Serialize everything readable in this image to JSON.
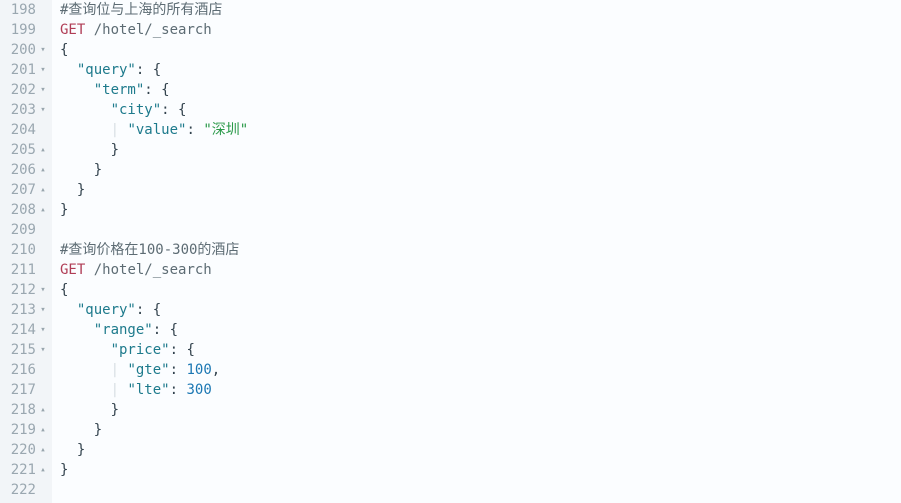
{
  "startLine": 198,
  "lines": [
    {
      "n": 198,
      "fold": "",
      "segs": [
        {
          "c": "tok-cm",
          "t": "#查询位与上海的所有酒店"
        }
      ]
    },
    {
      "n": 199,
      "fold": "",
      "segs": [
        {
          "c": "tok-mt",
          "t": "GET"
        },
        {
          "c": "",
          "t": " "
        },
        {
          "c": "tok-pt",
          "t": "/hotel/_search"
        }
      ]
    },
    {
      "n": 200,
      "fold": "dn",
      "segs": [
        {
          "c": "tok-pu",
          "t": "{"
        }
      ]
    },
    {
      "n": 201,
      "fold": "dn",
      "segs": [
        {
          "c": "",
          "t": "  "
        },
        {
          "c": "tok-ky",
          "t": "\"query\""
        },
        {
          "c": "tok-pu",
          "t": ": {"
        }
      ]
    },
    {
      "n": 202,
      "fold": "dn",
      "segs": [
        {
          "c": "",
          "t": "    "
        },
        {
          "c": "tok-ky",
          "t": "\"term\""
        },
        {
          "c": "tok-pu",
          "t": ": {"
        }
      ]
    },
    {
      "n": 203,
      "fold": "dn",
      "segs": [
        {
          "c": "",
          "t": "      "
        },
        {
          "c": "tok-ky",
          "t": "\"city\""
        },
        {
          "c": "tok-pu",
          "t": ": {"
        }
      ]
    },
    {
      "n": 204,
      "fold": "",
      "segs": [
        {
          "c": "",
          "t": "      "
        },
        {
          "c": "indent-guide",
          "t": "|"
        },
        {
          "c": "",
          "t": " "
        },
        {
          "c": "tok-ky",
          "t": "\"value\""
        },
        {
          "c": "tok-pu",
          "t": ": "
        },
        {
          "c": "tok-st",
          "t": "\"深圳\""
        }
      ]
    },
    {
      "n": 205,
      "fold": "up",
      "segs": [
        {
          "c": "",
          "t": "      "
        },
        {
          "c": "tok-pu",
          "t": "}"
        }
      ]
    },
    {
      "n": 206,
      "fold": "up",
      "segs": [
        {
          "c": "",
          "t": "    "
        },
        {
          "c": "tok-pu",
          "t": "}"
        }
      ]
    },
    {
      "n": 207,
      "fold": "up",
      "segs": [
        {
          "c": "",
          "t": "  "
        },
        {
          "c": "tok-pu",
          "t": "}"
        }
      ]
    },
    {
      "n": 208,
      "fold": "up",
      "segs": [
        {
          "c": "tok-pu",
          "t": "}"
        }
      ]
    },
    {
      "n": 209,
      "fold": "",
      "segs": []
    },
    {
      "n": 210,
      "fold": "",
      "segs": [
        {
          "c": "tok-cm",
          "t": "#查询价格在100-300的酒店"
        }
      ]
    },
    {
      "n": 211,
      "fold": "",
      "segs": [
        {
          "c": "tok-mt",
          "t": "GET"
        },
        {
          "c": "",
          "t": " "
        },
        {
          "c": "tok-pt",
          "t": "/hotel/_search"
        }
      ]
    },
    {
      "n": 212,
      "fold": "dn",
      "segs": [
        {
          "c": "tok-pu",
          "t": "{"
        }
      ]
    },
    {
      "n": 213,
      "fold": "dn",
      "segs": [
        {
          "c": "",
          "t": "  "
        },
        {
          "c": "tok-ky",
          "t": "\"query\""
        },
        {
          "c": "tok-pu",
          "t": ": {"
        }
      ]
    },
    {
      "n": 214,
      "fold": "dn",
      "segs": [
        {
          "c": "",
          "t": "    "
        },
        {
          "c": "tok-ky",
          "t": "\"range\""
        },
        {
          "c": "tok-pu",
          "t": ": {"
        }
      ]
    },
    {
      "n": 215,
      "fold": "dn",
      "segs": [
        {
          "c": "",
          "t": "      "
        },
        {
          "c": "tok-ky",
          "t": "\"price\""
        },
        {
          "c": "tok-pu",
          "t": ": {"
        }
      ]
    },
    {
      "n": 216,
      "fold": "",
      "segs": [
        {
          "c": "",
          "t": "      "
        },
        {
          "c": "indent-guide",
          "t": "|"
        },
        {
          "c": "",
          "t": " "
        },
        {
          "c": "tok-ky",
          "t": "\"gte\""
        },
        {
          "c": "tok-pu",
          "t": ": "
        },
        {
          "c": "tok-nu",
          "t": "100"
        },
        {
          "c": "tok-pu",
          "t": ","
        }
      ]
    },
    {
      "n": 217,
      "fold": "",
      "segs": [
        {
          "c": "",
          "t": "      "
        },
        {
          "c": "indent-guide",
          "t": "|"
        },
        {
          "c": "",
          "t": " "
        },
        {
          "c": "tok-ky",
          "t": "\"lte\""
        },
        {
          "c": "tok-pu",
          "t": ": "
        },
        {
          "c": "tok-nu",
          "t": "300"
        }
      ]
    },
    {
      "n": 218,
      "fold": "up",
      "segs": [
        {
          "c": "",
          "t": "      "
        },
        {
          "c": "tok-pu",
          "t": "}"
        }
      ]
    },
    {
      "n": 219,
      "fold": "up",
      "segs": [
        {
          "c": "",
          "t": "    "
        },
        {
          "c": "tok-pu",
          "t": "}"
        }
      ]
    },
    {
      "n": 220,
      "fold": "up",
      "segs": [
        {
          "c": "",
          "t": "  "
        },
        {
          "c": "tok-pu",
          "t": "}"
        }
      ]
    },
    {
      "n": 221,
      "fold": "up",
      "segs": [
        {
          "c": "tok-pu",
          "t": "}"
        }
      ]
    },
    {
      "n": 222,
      "fold": "",
      "segs": []
    }
  ],
  "foldGlyphs": {
    "dn": "▾",
    "up": "▴",
    "": ""
  }
}
